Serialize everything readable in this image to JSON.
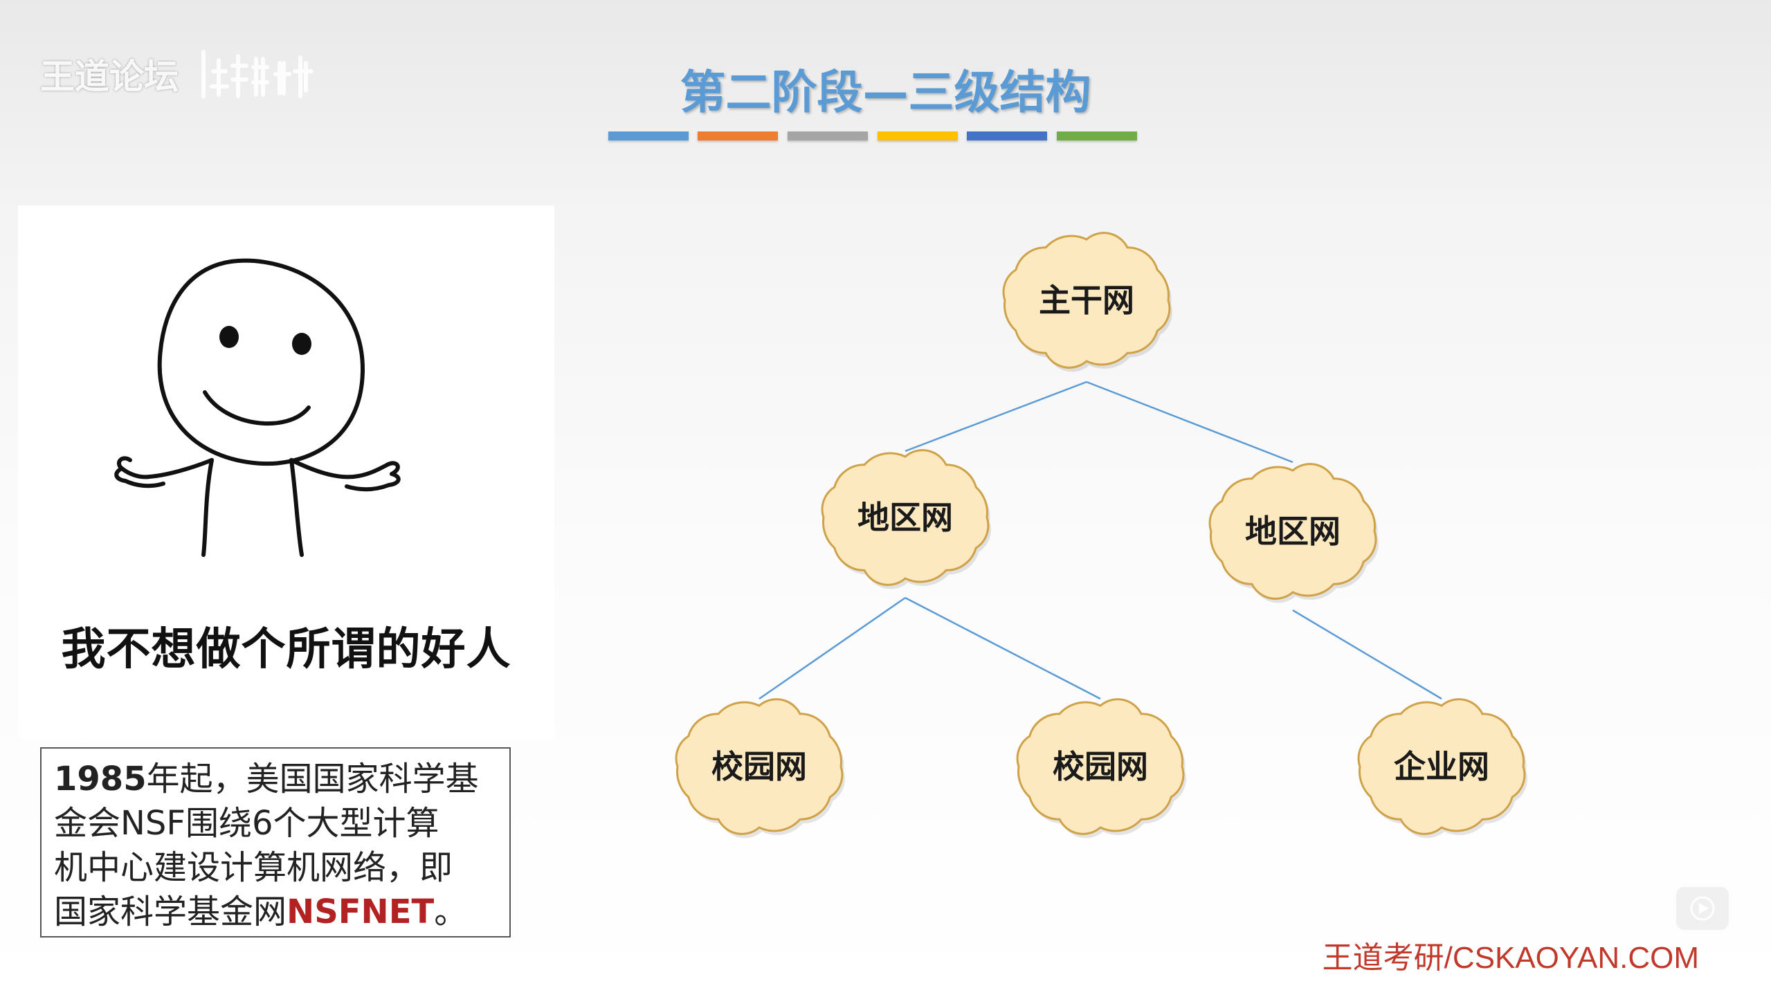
{
  "watermark": {
    "text": "王道论坛"
  },
  "title": "第二阶段—三级结构",
  "colors": {
    "title": "#5b9bd5",
    "bars": [
      "#5b9bd5",
      "#ed7d31",
      "#a5a5a5",
      "#ffc000",
      "#4472c4",
      "#70ad47"
    ],
    "cloud_fill": "#fde9c0",
    "cloud_stroke": "#cfa24a",
    "link": "#5b9bd5",
    "footer": "#c0392b",
    "nsfnet": "#b22222"
  },
  "meme": {
    "caption": "我不想做个所谓的好人"
  },
  "info": {
    "year": "1985",
    "lines": [
      "年起，美国国家科学基",
      "金会NSF围绕6个大型计算",
      "机中心建设计算机网络，即",
      "国家科学基金网"
    ],
    "highlight": "NSFNET",
    "end": "。"
  },
  "diagram": {
    "nodes": [
      {
        "id": "backbone",
        "label": "主干网"
      },
      {
        "id": "region1",
        "label": "地区网"
      },
      {
        "id": "region2",
        "label": "地区网"
      },
      {
        "id": "campus1",
        "label": "校园网"
      },
      {
        "id": "campus2",
        "label": "校园网"
      },
      {
        "id": "enterprise",
        "label": "企业网"
      }
    ],
    "edges": [
      [
        "backbone",
        "region1"
      ],
      [
        "backbone",
        "region2"
      ],
      [
        "region1",
        "campus1"
      ],
      [
        "region1",
        "campus2"
      ],
      [
        "region2",
        "enterprise"
      ]
    ]
  },
  "footer": "王道考研/CSKAOYAN.COM",
  "icons": {
    "play": "play-icon",
    "logo": "wangdao-logo-icon"
  }
}
